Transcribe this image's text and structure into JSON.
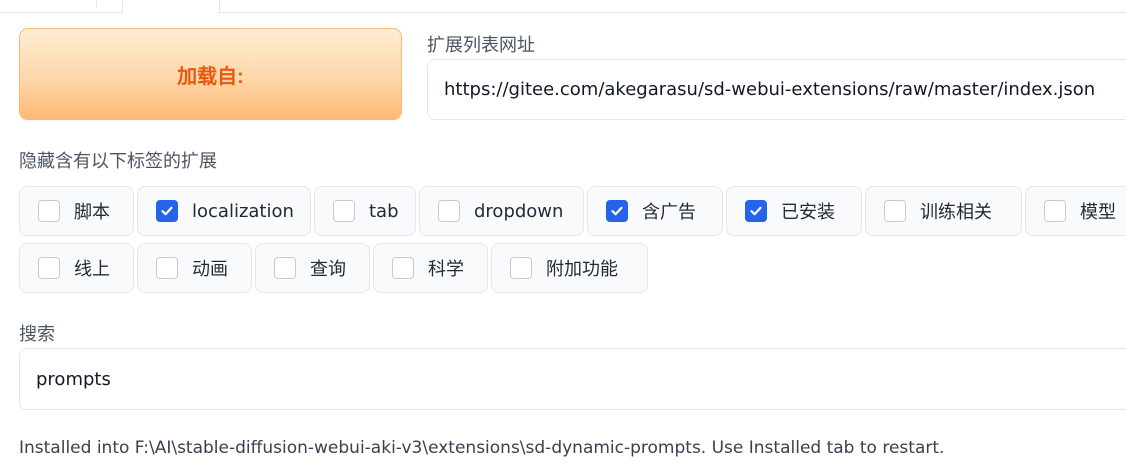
{
  "load_button": {
    "label": "加载自:"
  },
  "extension_list_url": {
    "label": "扩展列表网址",
    "value": "https://gitee.com/akegarasu/sd-webui-extensions/raw/master/index.json"
  },
  "hide_tags": {
    "label": "隐藏含有以下标签的扩展",
    "items": [
      {
        "label": "脚本",
        "checked": false
      },
      {
        "label": "localization",
        "checked": true
      },
      {
        "label": "tab",
        "checked": false
      },
      {
        "label": "dropdown",
        "checked": false
      },
      {
        "label": "含广告",
        "checked": true
      },
      {
        "label": "已安装",
        "checked": true
      },
      {
        "label": "训练相关",
        "checked": false
      },
      {
        "label": "模型",
        "checked": false
      },
      {
        "label": "线上",
        "checked": false
      },
      {
        "label": "动画",
        "checked": false
      },
      {
        "label": "查询",
        "checked": false
      },
      {
        "label": "科学",
        "checked": false
      },
      {
        "label": "附加功能",
        "checked": false
      }
    ]
  },
  "search": {
    "label": "搜索",
    "value": "prompts"
  },
  "status": {
    "text": "Installed into F:\\AI\\stable-diffusion-webui-aki-v3\\extensions\\sd-dynamic-prompts. Use Installed tab to restart."
  },
  "colors": {
    "accent": "#2563eb",
    "load_button_text": "#ea580c",
    "load_button_bg": "#fdba74"
  },
  "icons": {
    "checkmark": "check-icon"
  }
}
